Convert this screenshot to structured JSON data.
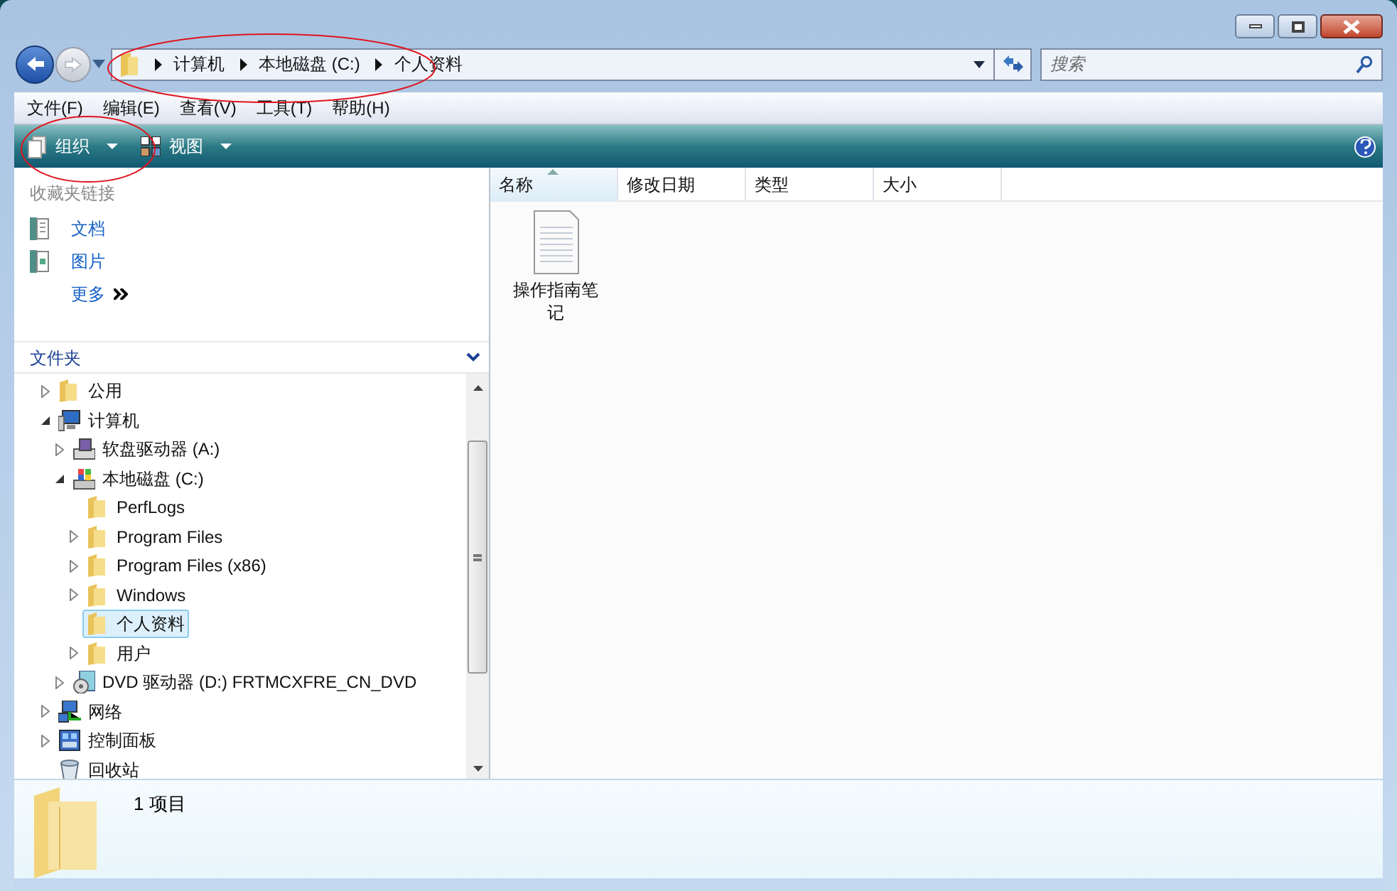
{
  "address_bar": {
    "segments": [
      "计算机",
      "本地磁盘 (C:)",
      "个人资料"
    ]
  },
  "search": {
    "placeholder": "搜索"
  },
  "menu": [
    "文件(F)",
    "编辑(E)",
    "查看(V)",
    "工具(T)",
    "帮助(H)"
  ],
  "toolbar": [
    {
      "label": "组织",
      "kind": "organize"
    },
    {
      "label": "视图",
      "kind": "views"
    }
  ],
  "favorites": {
    "title": "收藏夹链接",
    "items": [
      {
        "label": "文档",
        "kind": "documents"
      },
      {
        "label": "图片",
        "kind": "pictures"
      },
      {
        "label": "更多",
        "kind": "more"
      }
    ]
  },
  "folders": {
    "title": "文件夹",
    "tree": [
      {
        "label": "公用",
        "kind": "folder",
        "expanded": false,
        "selected": false
      },
      {
        "label": "计算机",
        "kind": "computer",
        "expanded": true,
        "selected": false,
        "children": [
          {
            "label": "软盘驱动器 (A:)",
            "kind": "floppy",
            "expanded": false,
            "selected": false
          },
          {
            "label": "本地磁盘 (C:)",
            "kind": "disk",
            "expanded": true,
            "selected": false,
            "children": [
              {
                "label": "PerfLogs",
                "kind": "folder",
                "selected": false
              },
              {
                "label": "Program Files",
                "kind": "folder",
                "expanded": false,
                "selected": false
              },
              {
                "label": "Program Files (x86)",
                "kind": "folder",
                "expanded": false,
                "selected": false
              },
              {
                "label": "Windows",
                "kind": "folder",
                "expanded": false,
                "selected": false
              },
              {
                "label": "个人资料",
                "kind": "folder",
                "selected": true
              },
              {
                "label": "用户",
                "kind": "folder",
                "expanded": false,
                "selected": false
              }
            ]
          },
          {
            "label": "DVD 驱动器 (D:) FRTMCXFRE_CN_DVD",
            "kind": "dvd",
            "expanded": false,
            "selected": false
          }
        ]
      },
      {
        "label": "网络",
        "kind": "network",
        "expanded": false,
        "selected": false
      },
      {
        "label": "控制面板",
        "kind": "control",
        "expanded": false,
        "selected": false
      },
      {
        "label": "回收站",
        "kind": "recycle",
        "selected": false
      }
    ]
  },
  "columns": [
    {
      "label": "名称",
      "sorted": true
    },
    {
      "label": "修改日期",
      "sorted": false
    },
    {
      "label": "类型",
      "sorted": false
    },
    {
      "label": "大小",
      "sorted": false
    }
  ],
  "files": [
    {
      "name": "操作指南笔记"
    }
  ],
  "status": {
    "text": "1 项目"
  }
}
